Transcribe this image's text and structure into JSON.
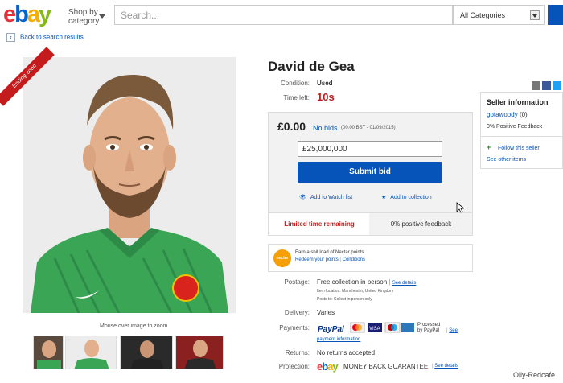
{
  "header": {
    "logo_e": "e",
    "logo_b": "b",
    "logo_a": "a",
    "logo_y": "y",
    "shop_by_1": "Shop by",
    "shop_by_2": "category",
    "search_placeholder": "Search...",
    "category_selected": "All Categories"
  },
  "nav": {
    "back_label": "Back to search results"
  },
  "gallery": {
    "ribbon": "Ending soon",
    "hint": "Mouse over image to zoom",
    "thumbnail_count": 4
  },
  "item": {
    "title": "David de Gea",
    "condition_label": "Condition:",
    "condition": "Used",
    "time_left_label": "Time left:",
    "time_left": "10s"
  },
  "bid": {
    "price": "£0.00",
    "bids": "No bids",
    "timestamp": "(00:00 BST - 01/09/2015)",
    "input_value": "£25,000,000",
    "submit_label": "Submit bid",
    "watch_label": "Add to Watch list",
    "collection_label": "Add to collection",
    "limited_label": "Limited time remaining",
    "feedback_label": "0% positive feedback"
  },
  "nectar": {
    "line1": "Earn a shit load of Nectar points",
    "redeem": "Redeem your points",
    "sep": "|",
    "conditions": "Conditions",
    "logo_text": "nectar"
  },
  "details": {
    "postage_label": "Postage:",
    "postage_value": "Free collection in person",
    "see_details": "See details",
    "item_location": "Item location: Manchester, United Kingdom",
    "posts_to": "Posts to: Collect in person only",
    "delivery_label": "Delivery:",
    "delivery_value": "Varies",
    "payments_label": "Payments:",
    "paypal": "PayPal",
    "processed": "Processed",
    "by_paypal": "by PayPal",
    "see": "See",
    "payment_information": "payment information",
    "returns_label": "Returns:",
    "returns_value": "No returns accepted",
    "protection_label": "Protection:",
    "mbg": "MONEY BACK GUARANTEE",
    "mbg_see": "See details"
  },
  "seller": {
    "heading": "Seller information",
    "name": "gotawoody",
    "score": "(0)",
    "feedback": "0% Positive Feedback",
    "follow": "Follow this seller",
    "other_items": "See other items"
  },
  "watermark": "Olly-Redcafe",
  "colors": {
    "ebay_blue": "#0654ba",
    "alert_red": "#c41c1c",
    "jersey_green": "#3aa655"
  }
}
